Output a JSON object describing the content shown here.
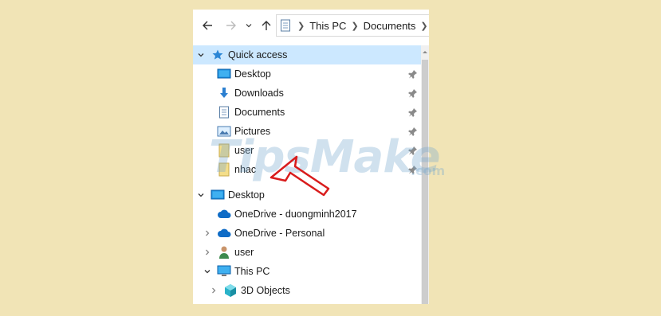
{
  "address_bar": {
    "segments": [
      "This PC",
      "Documents"
    ]
  },
  "tree": [
    {
      "name": "quick-access",
      "label": "Quick access",
      "level": 0,
      "expander": "expanded",
      "icon": "star-icon",
      "selected": true,
      "pinned": false
    },
    {
      "name": "desktop-qa",
      "label": "Desktop",
      "level": 1,
      "expander": "none",
      "icon": "desktop-icon",
      "pinned": true
    },
    {
      "name": "downloads",
      "label": "Downloads",
      "level": 1,
      "expander": "none",
      "icon": "download-icon",
      "pinned": true
    },
    {
      "name": "documents",
      "label": "Documents",
      "level": 1,
      "expander": "none",
      "icon": "document-icon",
      "pinned": true
    },
    {
      "name": "pictures",
      "label": "Pictures",
      "level": 1,
      "expander": "none",
      "icon": "pictures-icon",
      "pinned": true
    },
    {
      "name": "user-folder",
      "label": "user",
      "level": 1,
      "expander": "none",
      "icon": "folder-icon",
      "pinned": true
    },
    {
      "name": "nhac",
      "label": "nhac",
      "level": 1,
      "expander": "none",
      "icon": "folder-icon",
      "pinned": true
    },
    {
      "name": "desktop-root",
      "label": "Desktop",
      "level": 0,
      "expander": "expanded",
      "icon": "desktop-icon",
      "pinned": false,
      "gap": true
    },
    {
      "name": "onedrive-duong",
      "label": "OneDrive - duongminh2017",
      "level": 1,
      "expander": "none",
      "icon": "cloud-icon",
      "pinned": false
    },
    {
      "name": "onedrive-personal",
      "label": "OneDrive - Personal",
      "level": 1,
      "expander": "collapsed",
      "icon": "cloud-icon",
      "pinned": false
    },
    {
      "name": "user-profile",
      "label": "user",
      "level": 1,
      "expander": "collapsed",
      "icon": "user-icon",
      "pinned": false
    },
    {
      "name": "this-pc",
      "label": "This PC",
      "level": 1,
      "expander": "expanded",
      "icon": "computer-icon",
      "pinned": false
    },
    {
      "name": "3d-objects",
      "label": "3D Objects",
      "level": 2,
      "expander": "collapsed",
      "icon": "cube-icon",
      "pinned": false
    }
  ],
  "watermark": {
    "text": "TipsMake",
    "suffix": ".com"
  },
  "colors": {
    "background": "#f1e4b6",
    "selection": "#cce8ff",
    "arrow": "#d91c1c",
    "accent": "#1e7bd6"
  }
}
